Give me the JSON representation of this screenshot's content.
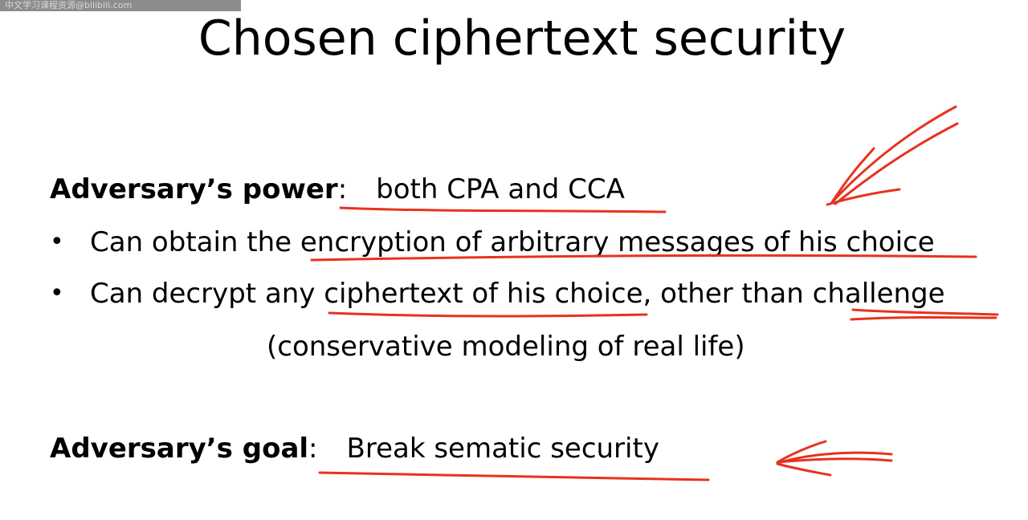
{
  "watermark": "中文学习课程资源@bilibili.com",
  "slide": {
    "title": "Chosen ciphertext security",
    "power": {
      "label": "Adversary’s power",
      "colon": ":",
      "value": "both CPA and CCA"
    },
    "bullets": [
      {
        "marker": "•",
        "prefix": "Can obtain the ",
        "highlight": "encryption of arbitrary messages of his choice"
      },
      {
        "marker": "•",
        "prefix": "Can decrypt any ",
        "highlight": "ciphertext of his choice",
        "middle": ", other than ",
        "highlight2": "challenge"
      }
    ],
    "note": "(conservative modeling of real life)",
    "goal": {
      "label": "Adversary’s goal",
      "colon": ":",
      "value": "Break sematic security"
    }
  },
  "annotation": {
    "ink_color": "#e8321e",
    "marks": [
      "underline",
      "arrow-icon"
    ]
  }
}
